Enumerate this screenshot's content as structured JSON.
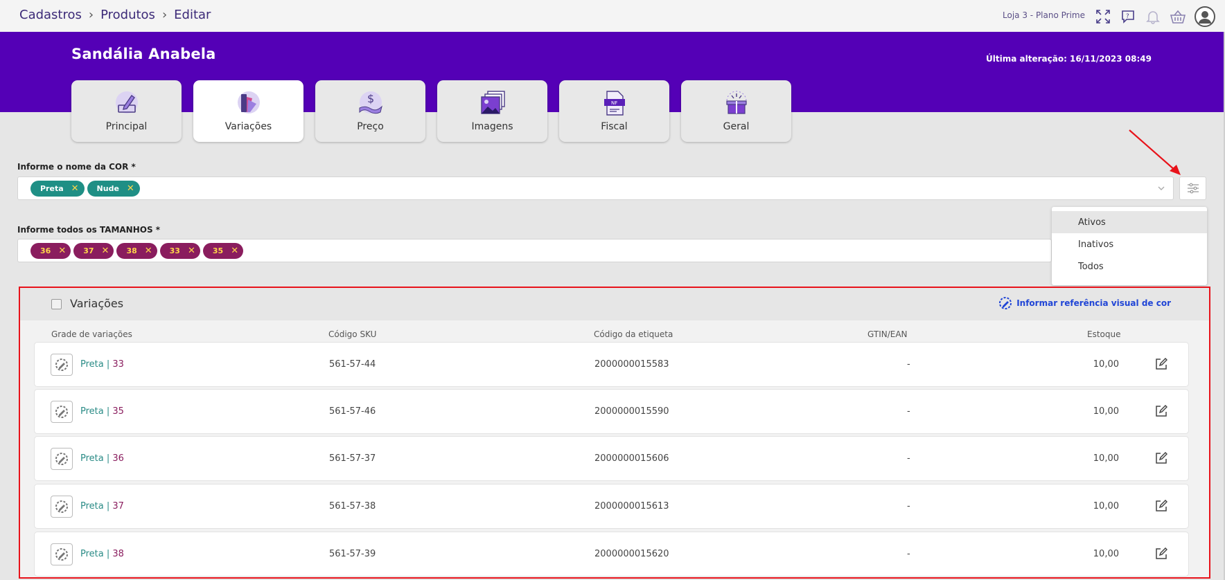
{
  "breadcrumb": [
    "Cadastros",
    "Produtos",
    "Editar"
  ],
  "header": {
    "store": "Loja 3 - Plano Prime",
    "icons": [
      "fullscreen-icon",
      "help-chat-icon",
      "bell-icon",
      "basket-icon",
      "user-avatar-icon"
    ]
  },
  "product": {
    "name": "Sandália Anabela",
    "last_change": "Última alteração: 16/11/2023 08:49"
  },
  "tabs": [
    {
      "label": "Principal",
      "icon": "pencil-box-icon",
      "active": false
    },
    {
      "label": "Variações",
      "icon": "color-swatch-icon",
      "active": true
    },
    {
      "label": "Preço",
      "icon": "price-hand-icon",
      "active": false
    },
    {
      "label": "Imagens",
      "icon": "images-icon",
      "active": false
    },
    {
      "label": "Fiscal",
      "icon": "invoice-nf-icon",
      "active": false
    },
    {
      "label": "Geral",
      "icon": "gift-box-icon",
      "active": false
    }
  ],
  "colors_field": {
    "label": "Informe o nome da COR *",
    "chips": [
      "Preta",
      "Nude"
    ]
  },
  "sizes_field": {
    "label": "Informe todos os TAMANHOS *",
    "chips": [
      "36",
      "37",
      "38",
      "33",
      "35"
    ]
  },
  "status_menu": {
    "items": [
      "Ativos",
      "Inativos",
      "Todos"
    ],
    "selected": "Ativos"
  },
  "variations": {
    "title": "Variações",
    "ref_link": "Informar referência visual de cor",
    "columns": [
      "Grade de variações",
      "Código SKU",
      "Código da etiqueta",
      "GTIN/EAN",
      "Estoque"
    ],
    "rows": [
      {
        "color": "Preta",
        "size": "33",
        "sku": "561-57-44",
        "label_code": "2000000015583",
        "gtin": "-",
        "stock": "10,00"
      },
      {
        "color": "Preta",
        "size": "35",
        "sku": "561-57-46",
        "label_code": "2000000015590",
        "gtin": "-",
        "stock": "10,00"
      },
      {
        "color": "Preta",
        "size": "36",
        "sku": "561-57-37",
        "label_code": "2000000015606",
        "gtin": "-",
        "stock": "10,00"
      },
      {
        "color": "Preta",
        "size": "37",
        "sku": "561-57-38",
        "label_code": "2000000015613",
        "gtin": "-",
        "stock": "10,00"
      },
      {
        "color": "Preta",
        "size": "38",
        "sku": "561-57-39",
        "label_code": "2000000015620",
        "gtin": "-",
        "stock": "10,00"
      }
    ]
  },
  "colors": {
    "banner": "#5400b6",
    "teal_chip": "#1f8f85",
    "plum_chip": "#8a1d5e",
    "highlight": "#e8121a",
    "link": "#2045d6"
  }
}
